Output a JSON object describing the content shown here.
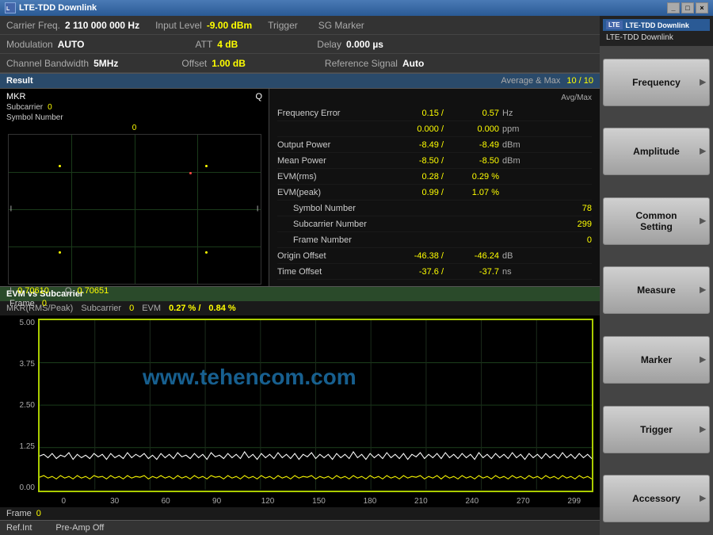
{
  "titleBar": {
    "title": "LTE-TDD Downlink",
    "icon": "LTE"
  },
  "header": {
    "row1": {
      "carrierFreqLabel": "Carrier Freq.",
      "carrierFreqValue": "2 110 000 000 Hz",
      "inputLevelLabel": "Input Level",
      "inputLevelValue": "-9.00 dBm",
      "triggerLabel": "Trigger",
      "triggerValue": "",
      "sgMarkerLabel": "SG Marker",
      "sgMarkerValue": ""
    },
    "row2": {
      "modulationLabel": "Modulation",
      "modulationValue": "AUTO",
      "attLabel": "ATT",
      "attValue": "4 dB",
      "delayLabel": "Delay",
      "delayValue": "0.000 µs"
    },
    "row3": {
      "channelBWLabel": "Channel Bandwidth",
      "channelBWValue": "5MHz",
      "offsetLabel": "Offset",
      "offsetValue": "1.00 dB",
      "refSignalLabel": "Reference Signal",
      "refSignalValue": "Auto"
    }
  },
  "resultBar": {
    "label": "Result",
    "avgMaxLabel": "Average & Max",
    "avgMaxValue": "10 /  10",
    "avgMaxHeader": "Avg/Max"
  },
  "constellation": {
    "mkrLabel": "MKR",
    "qLabel": "Q",
    "subcarrierLabel": "Subcarrier",
    "subcarrierValue": "0",
    "symbolNumberLabel": "Symbol Number",
    "symbolNumberValue": "0",
    "iLabel": "I",
    "iValue": "0.70610",
    "qValueLabel": "Q",
    "qValue": "0.70651",
    "lLabel": "I",
    "frameLabel": "Frame",
    "frameValue": "0"
  },
  "measurements": {
    "header": "Avg/Max",
    "items": [
      {
        "name": "Frequency Error",
        "val1": "0.15 /",
        "val2": "0.57",
        "unit": "Hz"
      },
      {
        "name": "",
        "val1": "0.000 /",
        "val2": "0.000",
        "unit": "ppm"
      },
      {
        "name": "Output Power",
        "val1": "-8.49 /",
        "val2": "-8.49",
        "unit": "dBm"
      },
      {
        "name": "Mean Power",
        "val1": "-8.50 /",
        "val2": "-8.50",
        "unit": "dBm"
      },
      {
        "name": "EVM(rms)",
        "val1": "0.28 /",
        "val2": "0.29",
        "unit": "%"
      },
      {
        "name": "EVM(peak)",
        "val1": "0.99 /",
        "val2": "1.07",
        "unit": "%"
      },
      {
        "name": "Symbol Number",
        "val1": "",
        "val2": "78",
        "unit": "",
        "single": true
      },
      {
        "name": "Subcarrier Number",
        "val1": "",
        "val2": "299",
        "unit": "",
        "single": true
      },
      {
        "name": "Frame Number",
        "val1": "",
        "val2": "0",
        "unit": "",
        "single": true
      },
      {
        "name": "Origin Offset",
        "val1": "-46.38 /",
        "val2": "-46.24",
        "unit": "dB"
      },
      {
        "name": "Time Offset",
        "val1": "-37.6 /",
        "val2": "-37.7",
        "unit": "ns"
      }
    ]
  },
  "evmSection": {
    "title": "EVM vs Subcarrier",
    "mkrLabel": "MKR(RMS/Peak)",
    "subcarrierLabel": "Subcarrier",
    "subcarrierValue": "0",
    "evmLabel": "EVM",
    "evmVal1": "0.27 % /",
    "evmVal2": "0.84 %",
    "yAxisLabels": [
      "5.00",
      "3.75",
      "2.50",
      "1.25",
      "0.00"
    ],
    "xAxisLabels": [
      "0",
      "30",
      "60",
      "90",
      "120",
      "150",
      "180",
      "210",
      "240",
      "270",
      "299"
    ],
    "frameLabel": "Frame",
    "frameValue": "0"
  },
  "statusBar": {
    "refInt": "Ref.Int",
    "preAmp": "Pre-Amp Off"
  },
  "sidebar": {
    "appTitle1": "LTE-TDD Downlink",
    "appTitle2": "LTE-TDD Downlink",
    "buttons": [
      {
        "label": "Frequency",
        "active": false
      },
      {
        "label": "Amplitude",
        "active": false
      },
      {
        "label": "Common\nSetting",
        "active": false
      },
      {
        "label": "Measure",
        "active": false
      },
      {
        "label": "Marker",
        "active": false
      },
      {
        "label": "Trigger",
        "active": false
      },
      {
        "label": "Accessory",
        "active": false
      }
    ]
  },
  "watermark": "www.tehencom.com"
}
